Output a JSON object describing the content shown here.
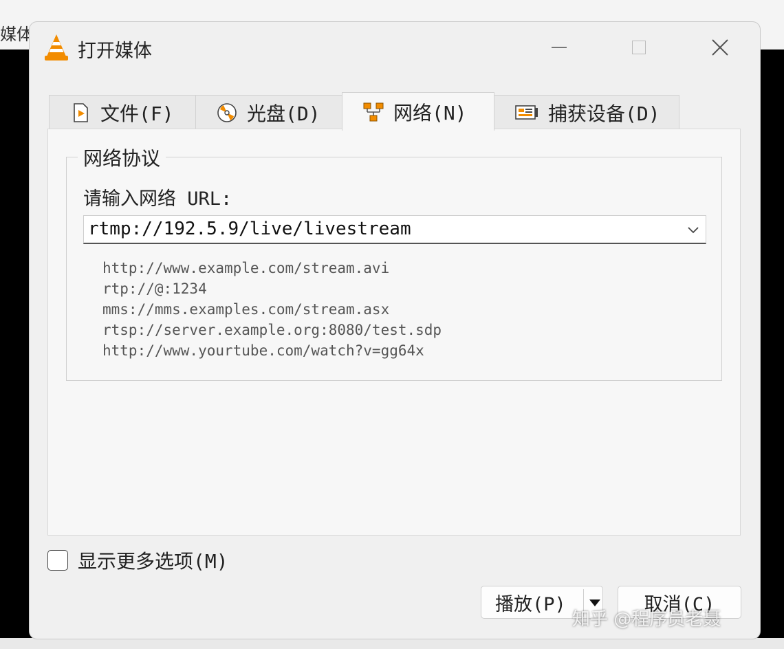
{
  "background": {
    "behind_window_text": "媒体"
  },
  "window": {
    "title": "打开媒体",
    "app_icon": "vlc-cone-icon"
  },
  "tabs": [
    {
      "label": "文件(F)",
      "icon": "file-play-icon"
    },
    {
      "label": "光盘(D)",
      "icon": "disc-icon"
    },
    {
      "label": "网络(N)",
      "icon": "network-icon",
      "active": true
    },
    {
      "label": "捕获设备(D)",
      "icon": "capture-card-icon"
    }
  ],
  "network": {
    "group_title": "网络协议",
    "url_label": "请输入网络 URL:",
    "url_value": "rtmp://192.5.9/live/livestream",
    "examples": [
      "http://www.example.com/stream.avi",
      "rtp://@:1234",
      "mms://mms.examples.com/stream.asx",
      "rtsp://server.example.org:8080/test.sdp",
      "http://www.yourtube.com/watch?v=gg64x"
    ]
  },
  "options": {
    "show_more_label": "显示更多选项(M)",
    "show_more_checked": false
  },
  "buttons": {
    "play": "播放(P)",
    "cancel": "取消(C)"
  },
  "watermark": "知乎 @程序员老聂",
  "colors": {
    "vlc_orange": "#f28c00",
    "accent_border": "#555555"
  }
}
